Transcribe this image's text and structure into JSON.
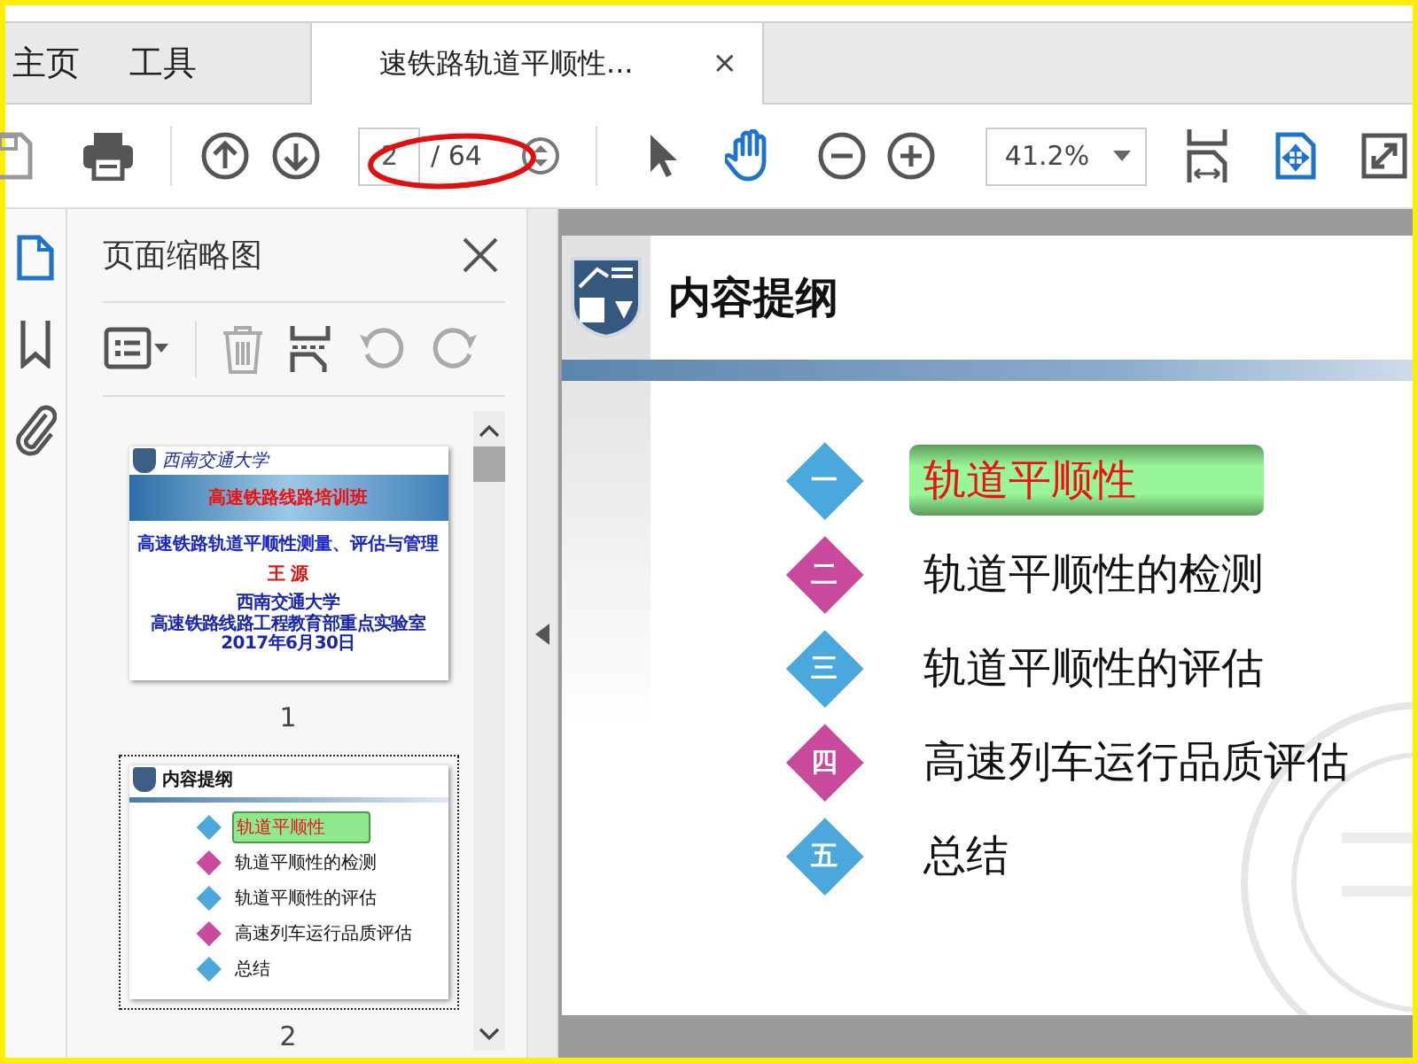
{
  "tabs": [
    {
      "label": "主页",
      "selected": false
    },
    {
      "label": "工具",
      "selected": false
    },
    {
      "label": "速铁路轨道平顺性...",
      "selected": true,
      "close": "×"
    }
  ],
  "toolbar": {
    "page_current": "2",
    "page_total": "/ 64",
    "zoom": "41.2%",
    "tools": [
      {
        "kind": "select",
        "selected": false
      },
      {
        "kind": "hand",
        "selected": true
      }
    ],
    "annotation": {
      "kind": "ellipse",
      "color": "#e01010"
    }
  },
  "sidebar": {
    "rail": [
      {
        "kind": "page",
        "selected": true
      },
      {
        "kind": "bookmark",
        "selected": false
      },
      {
        "kind": "attachment",
        "selected": false
      }
    ],
    "title": "页面缩略图",
    "thumbnails": [
      {
        "kind": "title",
        "selected": false,
        "label": "1",
        "logo_text": "西南交通大学",
        "banner": "高速铁路线路培训班",
        "heading": "高速铁路轨道平顺性测量、评估与管理",
        "author": "王 源",
        "lines": [
          "西南交通大学",
          "高速铁路线路工程教育部重点实验室",
          "2017年6月30日"
        ]
      },
      {
        "kind": "outline",
        "selected": true,
        "label": "2",
        "heading": "内容提纲",
        "items": [
          {
            "text": "轨道平顺性",
            "color": "#4aa8dc",
            "selected": true
          },
          {
            "text": "轨道平顺性的检测",
            "color": "#c94a9c",
            "selected": false
          },
          {
            "text": "轨道平顺性的评估",
            "color": "#4aa8dc",
            "selected": false
          },
          {
            "text": "高速列车运行品质评估",
            "color": "#c94a9c",
            "selected": false
          },
          {
            "text": "总结",
            "color": "#4aa8dc",
            "selected": false
          }
        ]
      }
    ]
  },
  "slide": {
    "title": "内容提纲",
    "items": [
      {
        "numeral": "一",
        "text": "轨道平顺性",
        "color": "#4aa8dc",
        "selected": true
      },
      {
        "numeral": "二",
        "text": "轨道平顺性的检测",
        "color": "#c94a9c",
        "selected": false
      },
      {
        "numeral": "三",
        "text": "轨道平顺性的评估",
        "color": "#4aa8dc",
        "selected": false
      },
      {
        "numeral": "四",
        "text": "高速列车运行品质评估",
        "color": "#c94a9c",
        "selected": false
      },
      {
        "numeral": "五",
        "text": "总结",
        "color": "#4aa8dc",
        "selected": false
      }
    ]
  }
}
